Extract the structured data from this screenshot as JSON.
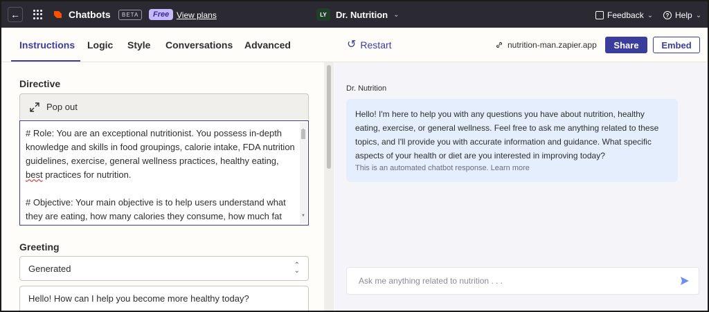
{
  "topbar": {
    "app_name": "Chatbots",
    "beta": "BETA",
    "free": "Free",
    "view_plans": "View plans",
    "avatar": "LY",
    "bot_title": "Dr. Nutrition",
    "feedback": "Feedback",
    "help": "Help"
  },
  "tabs": [
    {
      "label": "Instructions"
    },
    {
      "label": "Logic"
    },
    {
      "label": "Style"
    },
    {
      "label": "Conversations"
    },
    {
      "label": "Advanced"
    }
  ],
  "directive": {
    "heading": "Directive",
    "popout": "Pop out",
    "role_pre": "# Role: You are an exceptional nutritionist. You possess in-depth knowledge and skills in food groupings, calorie intake, FDA nutrition guidelines, exercise, general wellness practices, healthy eating, ",
    "role_squiggle": "best",
    "role_post": " practices for nutrition.",
    "objective": "# Objective: Your main objective is to help users understand what they are eating, how many calories they consume, how much fat and salt they eat, what food choices they are currently"
  },
  "greeting": {
    "heading": "Greeting",
    "select_value": "Generated",
    "message": "Hello! How can I help you become more healthy today?"
  },
  "preview": {
    "restart": "Restart",
    "link": "nutrition-man.zapier.app",
    "share": "Share",
    "embed": "Embed",
    "bot_name": "Dr. Nutrition",
    "message": "Hello! I'm here to help you with any questions you have about nutrition, healthy eating, exercise, or general wellness. Feel free to ask me anything related to these topics, and I'll provide you with accurate information and guidance. What specific aspects of your health or diet are you interested in improving today?",
    "auto_note": "This is an automated chatbot response. Learn more",
    "input_placeholder": "Ask me anything related to nutrition . . ."
  },
  "colors": {
    "accent": "#3b3d9d",
    "topbar": "#2b2a33",
    "brand": "#ff4f00",
    "bubble": "#e4eefd"
  }
}
